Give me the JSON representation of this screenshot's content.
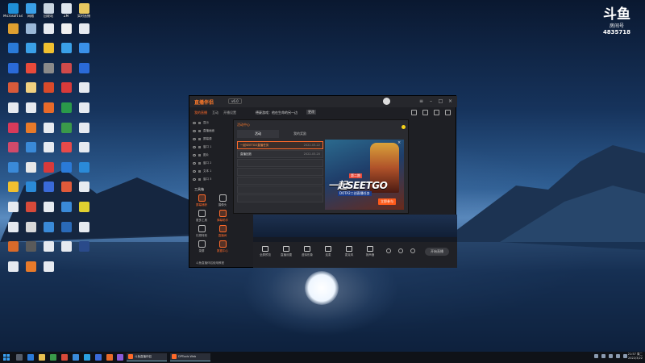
{
  "desktop": {
    "icons": [
      {
        "label": "Microsoft Edge",
        "icon": "edge-icon",
        "color": "#1f8fd8"
      },
      {
        "label": "网络",
        "icon": "network-icon",
        "color": "#3aa0e8"
      },
      {
        "label": "回收站",
        "icon": "recycle-bin-icon",
        "color": "#c8d4e0"
      },
      {
        "label": "ZM",
        "icon": "file-icon",
        "color": "#dfe6ee"
      },
      {
        "label": "实时直播",
        "icon": "folder-icon",
        "color": "#e8c860"
      },
      {
        "label": "",
        "icon": "app-icon",
        "color": "#e0a030"
      },
      {
        "label": "",
        "icon": "computer-icon",
        "color": "#9ab8d8"
      },
      {
        "label": "",
        "icon": "doc-icon",
        "color": "#e6eaf0"
      },
      {
        "label": "",
        "icon": "app-icon",
        "color": "#f0f0f0"
      },
      {
        "label": "",
        "icon": "doc-icon",
        "color": "#e6eaf0"
      },
      {
        "label": "",
        "icon": "app-icon",
        "color": "#2a7ad8"
      },
      {
        "label": "",
        "icon": "doc-icon",
        "color": "#3aa0e8"
      },
      {
        "label": "",
        "icon": "app-icon",
        "color": "#f0c030"
      },
      {
        "label": "",
        "icon": "app-icon",
        "color": "#3aa0e8"
      },
      {
        "label": "",
        "icon": "app-icon",
        "color": "#3a90e8"
      },
      {
        "label": "",
        "icon": "app-icon",
        "color": "#2a6ad8"
      },
      {
        "label": "",
        "icon": "app-icon",
        "color": "#e84a3a"
      },
      {
        "label": "",
        "icon": "app-icon",
        "color": "#8a8a8a"
      },
      {
        "label": "",
        "icon": "app-icon",
        "color": "#d04a4a"
      },
      {
        "label": "",
        "icon": "app-icon",
        "color": "#2a6ad8"
      },
      {
        "label": "",
        "icon": "app-icon",
        "color": "#d85a3a"
      },
      {
        "label": "",
        "icon": "doc-icon",
        "color": "#f0d080"
      },
      {
        "label": "",
        "icon": "app-icon",
        "color": "#d84a2a"
      },
      {
        "label": "",
        "icon": "app-icon",
        "color": "#d83a3a"
      },
      {
        "label": "",
        "icon": "doc-icon",
        "color": "#e6eaf0"
      },
      {
        "label": "",
        "icon": "doc-icon",
        "color": "#e6eaf0"
      },
      {
        "label": "",
        "icon": "doc-icon",
        "color": "#e6eaf0"
      },
      {
        "label": "",
        "icon": "app-icon",
        "color": "#e86a2a"
      },
      {
        "label": "",
        "icon": "app-icon",
        "color": "#2a9a4a"
      },
      {
        "label": "",
        "icon": "doc-icon",
        "color": "#e6eaf0"
      },
      {
        "label": "",
        "icon": "app-icon",
        "color": "#d83a5a"
      },
      {
        "label": "",
        "icon": "app-icon",
        "color": "#e87a2a"
      },
      {
        "label": "",
        "icon": "doc-icon",
        "color": "#e6eaf0"
      },
      {
        "label": "",
        "icon": "app-icon",
        "color": "#3a9a4a"
      },
      {
        "label": "",
        "icon": "doc-icon",
        "color": "#e6eaf0"
      },
      {
        "label": "",
        "icon": "app-icon",
        "color": "#d04a6a"
      },
      {
        "label": "",
        "icon": "app-icon",
        "color": "#3a8ad8"
      },
      {
        "label": "",
        "icon": "doc-icon",
        "color": "#e6eaf0"
      },
      {
        "label": "",
        "icon": "app-icon",
        "color": "#e84a4a"
      },
      {
        "label": "",
        "icon": "doc-icon",
        "color": "#e6eaf0"
      },
      {
        "label": "",
        "icon": "app-icon",
        "color": "#3a8ad8"
      },
      {
        "label": "",
        "icon": "app-icon",
        "color": "#e8e8e8"
      },
      {
        "label": "",
        "icon": "app-icon",
        "color": "#d83a3a"
      },
      {
        "label": "",
        "icon": "app-icon",
        "color": "#2a7ad8"
      },
      {
        "label": "",
        "icon": "app-icon",
        "color": "#2a8ad8"
      },
      {
        "label": "",
        "icon": "app-icon",
        "color": "#f0c030"
      },
      {
        "label": "",
        "icon": "app-icon",
        "color": "#2a8ad8"
      },
      {
        "label": "",
        "icon": "app-icon",
        "color": "#3a6ad8"
      },
      {
        "label": "",
        "icon": "app-icon",
        "color": "#e05a3a"
      },
      {
        "label": "",
        "icon": "doc-icon",
        "color": "#e6eaf0"
      },
      {
        "label": "",
        "icon": "doc-icon",
        "color": "#e6eaf0"
      },
      {
        "label": "",
        "icon": "app-icon",
        "color": "#d84a3a"
      },
      {
        "label": "",
        "icon": "doc-icon",
        "color": "#e6eaf0"
      },
      {
        "label": "",
        "icon": "app-icon",
        "color": "#3a8ad8"
      },
      {
        "label": "",
        "icon": "app-icon",
        "color": "#e0d030"
      },
      {
        "label": "",
        "icon": "doc-icon",
        "color": "#e6eaf0"
      },
      {
        "label": "",
        "icon": "app-icon",
        "color": "#d8d8d8"
      },
      {
        "label": "",
        "icon": "app-icon",
        "color": "#3a8ad8"
      },
      {
        "label": "",
        "icon": "app-icon",
        "color": "#2a6ab8"
      },
      {
        "label": "",
        "icon": "doc-icon",
        "color": "#e6eaf0"
      },
      {
        "label": "",
        "icon": "app-icon",
        "color": "#d86a2a"
      },
      {
        "label": "",
        "icon": "app-icon",
        "color": "#5a5a5a"
      },
      {
        "label": "",
        "icon": "doc-icon",
        "color": "#e6eaf0"
      },
      {
        "label": "",
        "icon": "doc-icon",
        "color": "#e6eaf0"
      },
      {
        "label": "",
        "icon": "app-icon",
        "color": "#2a4a8a"
      },
      {
        "label": "",
        "icon": "doc-icon",
        "color": "#e6eaf0"
      },
      {
        "label": "",
        "icon": "app-icon",
        "color": "#e87a2a"
      },
      {
        "label": "",
        "icon": "doc-icon",
        "color": "#e6eaf0"
      }
    ]
  },
  "room_badge": {
    "logo": "斗鱼",
    "label": "房间号",
    "number": "4835718"
  },
  "app": {
    "brand": "直播伴侣",
    "version": "v6.0",
    "nav_tabs": [
      "我的直播",
      "互动",
      "开播设置"
    ],
    "room_title": "德豪游戏：他在生命的另一边",
    "room_tag": "更改",
    "scenes": [
      "显示",
      "直播画面",
      "屏幕源",
      "窗口 1",
      "图片",
      "窗口 2",
      "文本 1",
      "窗口 3"
    ],
    "section_title": "工具箱",
    "tools": [
      {
        "label": "屏幕捕获",
        "icon": "screen-capture-icon",
        "active": true
      },
      {
        "label": "摄像头",
        "icon": "camera-icon",
        "active": false
      },
      {
        "label": "更多工具",
        "icon": "more-tools-icon",
        "active": false
      },
      {
        "label": "弹幕助手",
        "icon": "danmaku-icon",
        "active": true
      },
      {
        "label": "礼物特效",
        "icon": "gift-icon",
        "active": false
      },
      {
        "label": "直播间",
        "icon": "room-icon",
        "active": true
      },
      {
        "label": "录屏",
        "icon": "record-icon",
        "active": false
      },
      {
        "label": "数据中心",
        "icon": "data-center-icon",
        "active": true
      }
    ],
    "bottom_link": "斗鱼直播伴侣使用教程",
    "bottom_buttons": [
      {
        "label": "全屏预览",
        "icon": "fullscreen-icon"
      },
      {
        "label": "直播设置",
        "icon": "live-settings-icon"
      },
      {
        "label": "虚拟形象",
        "icon": "avatar-icon"
      },
      {
        "label": "连麦",
        "icon": "link-mic-icon"
      },
      {
        "label": "麦克风",
        "icon": "mic-icon"
      },
      {
        "label": "扬声器",
        "icon": "speaker-icon"
      }
    ],
    "go_live": "开始直播"
  },
  "panel": {
    "title": "活动中心",
    "tabs": [
      "活动",
      "我的奖励"
    ],
    "items": [
      {
        "name": "一起SEETGO直播任务",
        "date": "2022-03-22",
        "selected": true
      },
      {
        "name": "直播回放",
        "date": "2022-03-20",
        "selected": false
      }
    ],
    "banner": {
      "tag": "第二期",
      "headline": "一起SEETGO",
      "subline": "DOTA2二创直播任务",
      "cta": "立即参与",
      "close": "×"
    }
  },
  "taskbar": {
    "tasks": [
      "斗鱼直播伴侣",
      "DPTools Web"
    ],
    "clock_time": "21:57 周二",
    "clock_date": "2022/3/22"
  }
}
